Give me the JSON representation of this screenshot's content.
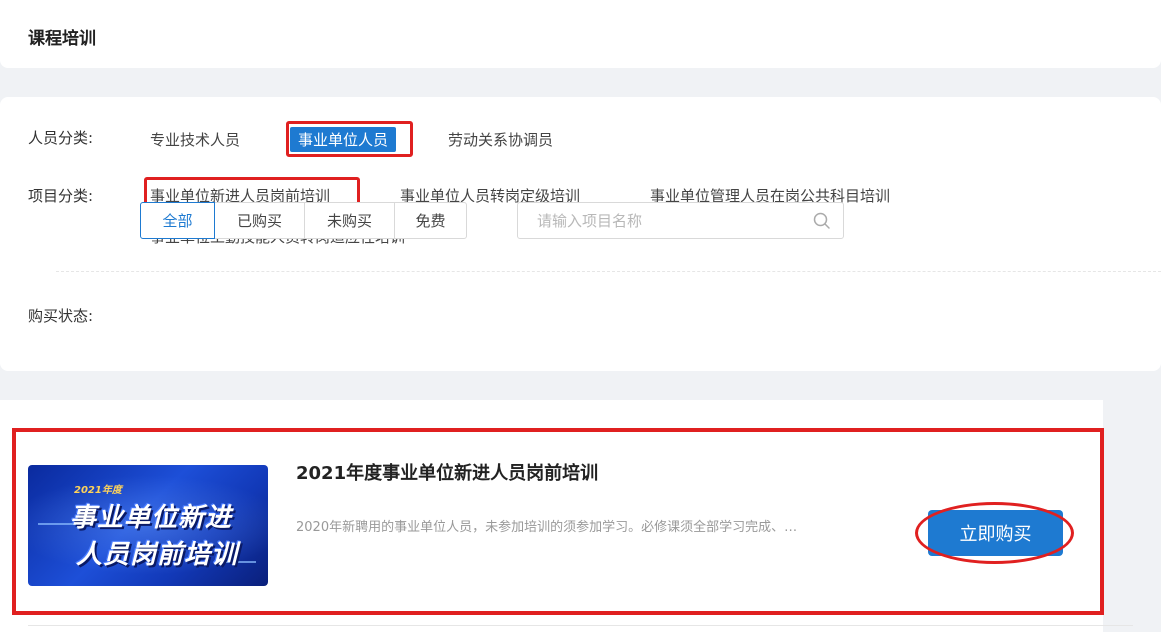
{
  "header": {
    "title": "课程培训"
  },
  "filters": {
    "personnel": {
      "label": "人员分类:",
      "options": [
        "专业技术人员",
        "事业单位人员",
        "劳动关系协调员"
      ],
      "selected": "事业单位人员"
    },
    "project": {
      "label": "项目分类:",
      "options": [
        "事业单位新进人员岗前培训",
        "事业单位人员转岗定级培训",
        "事业单位管理人员在岗公共科目培训",
        "事业单位工勤技能人员转岗适应性培训"
      ],
      "selected": "事业单位新进人员岗前培训"
    },
    "purchase": {
      "label": "购买状态:",
      "options": [
        "全部",
        "已购买",
        "未购买",
        "免费"
      ],
      "selected": "全部"
    },
    "search": {
      "placeholder": "请输入项目名称",
      "icon": "search-icon"
    }
  },
  "course": {
    "thumb": {
      "year": "2021年度",
      "line1": "事业单位新进",
      "line2": "人员岗前培训"
    },
    "title": "2021年度事业单位新进人员岗前培训",
    "description": "2020年新聘用的事业单位人员，未参加培训的须参加学习。必修课须全部学习完成、…",
    "buy_label": "立即购买"
  },
  "colors": {
    "accent": "#1e7ad1",
    "annotation_red": "#e02020"
  }
}
